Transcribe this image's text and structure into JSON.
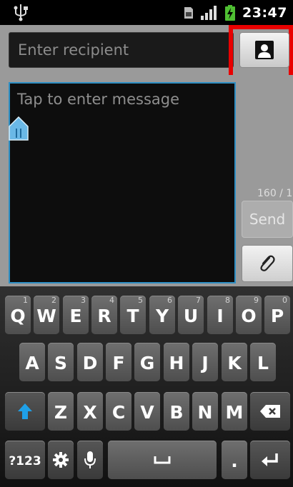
{
  "status_bar": {
    "time": "23:47"
  },
  "recipient": {
    "placeholder": "Enter recipient"
  },
  "message": {
    "placeholder": "Tap to enter message",
    "counter": "160 / 1",
    "send_label": "Send"
  },
  "keyboard": {
    "row1": [
      {
        "label": "Q",
        "hint": "1"
      },
      {
        "label": "W",
        "hint": "2"
      },
      {
        "label": "E",
        "hint": "3"
      },
      {
        "label": "R",
        "hint": "4"
      },
      {
        "label": "T",
        "hint": "5"
      },
      {
        "label": "Y",
        "hint": "6"
      },
      {
        "label": "U",
        "hint": "7"
      },
      {
        "label": "I",
        "hint": "8"
      },
      {
        "label": "O",
        "hint": "9"
      },
      {
        "label": "P",
        "hint": "0"
      }
    ],
    "row2": [
      "A",
      "S",
      "D",
      "F",
      "G",
      "H",
      "J",
      "K",
      "L"
    ],
    "row3": [
      "Z",
      "X",
      "C",
      "V",
      "B",
      "N",
      "M"
    ],
    "symbols_label": "?123",
    "period_label": "."
  },
  "icons": {
    "usb": "usb-icon",
    "sim": "sim-card-icon",
    "signal": "signal-icon",
    "battery": "battery-charging-icon",
    "contact": "contact-icon",
    "attach": "paperclip-icon",
    "shift": "shift-arrow-icon",
    "backspace": "backspace-icon",
    "settings": "gear-icon",
    "mic": "microphone-icon",
    "space": "space-icon",
    "enter": "enter-icon"
  },
  "colors": {
    "focus_border": "#2e8fc4",
    "highlight": "#e80000",
    "shift_arrow": "#1fa0e8"
  }
}
